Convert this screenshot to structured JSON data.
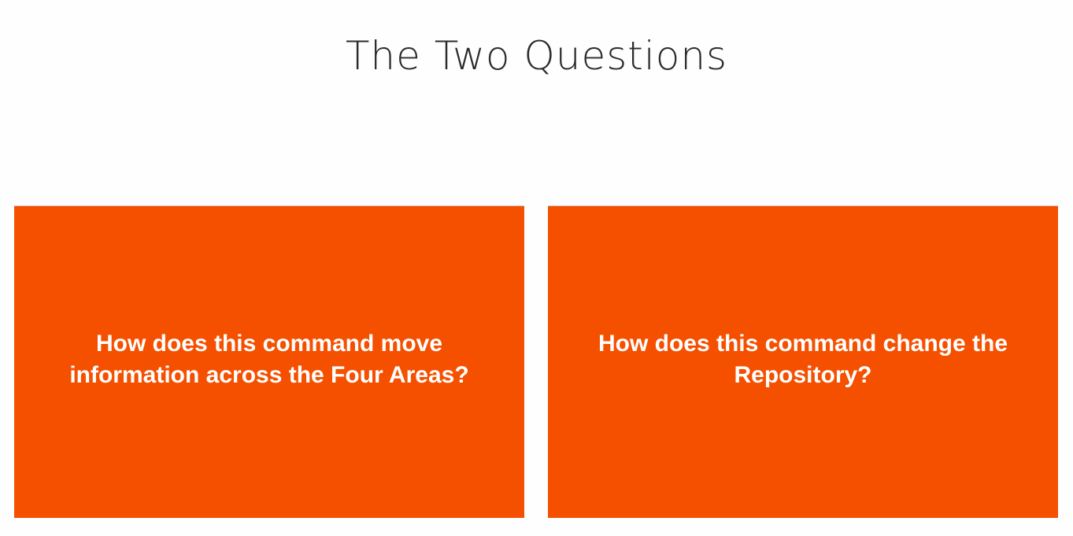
{
  "slide": {
    "title": "The Two Questions",
    "accent_color": "#f55000",
    "cards": [
      {
        "text": "How does this command move information across the Four Areas?"
      },
      {
        "text": "How does this command change the Repository?"
      }
    ]
  }
}
